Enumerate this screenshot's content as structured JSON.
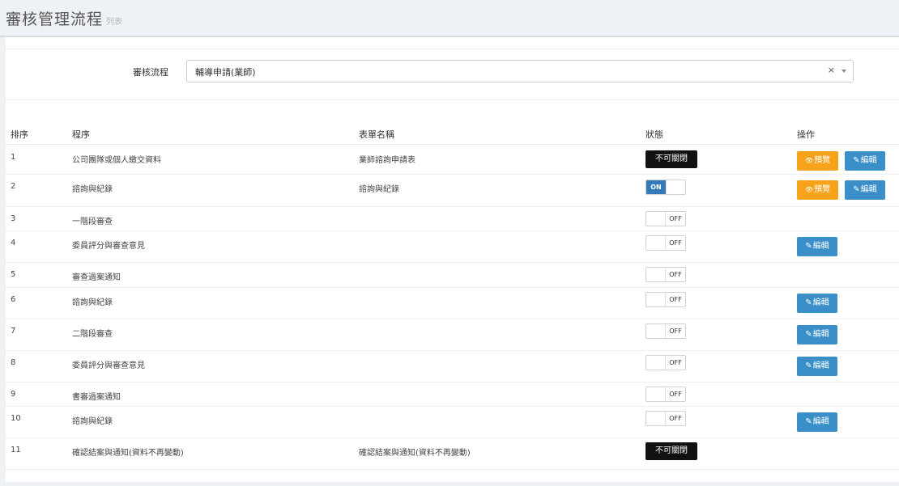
{
  "header": {
    "title": "審核管理流程",
    "subtitle": "列表"
  },
  "filter": {
    "label": "審核流程",
    "value": "輔導申請(業師)",
    "clear": "×"
  },
  "columns": {
    "num": "排序",
    "step": "程序",
    "form": "表單名稱",
    "status": "狀態",
    "actions": "操作"
  },
  "labels": {
    "locked": "不可關閉",
    "on": "ON",
    "off": "OFF",
    "preview": "預覽",
    "edit": "編輯"
  },
  "rows": [
    {
      "num": "1",
      "step": "公司團隊或個人繳交資料",
      "form": "業師諮詢申請表",
      "status": "locked",
      "preview": true,
      "edit": true
    },
    {
      "num": "2",
      "step": "諮詢與紀錄",
      "form": "諮詢與紀錄",
      "status": "on",
      "preview": true,
      "edit": true
    },
    {
      "num": "3",
      "step": "一階段審查",
      "form": "",
      "status": "off",
      "preview": false,
      "edit": false
    },
    {
      "num": "4",
      "step": "委員評分與審查意見",
      "form": "",
      "status": "off",
      "preview": false,
      "edit": true
    },
    {
      "num": "5",
      "step": "審查過案通知",
      "form": "",
      "status": "off",
      "preview": false,
      "edit": false
    },
    {
      "num": "6",
      "step": "諮詢與紀錄",
      "form": "",
      "status": "off",
      "preview": false,
      "edit": true
    },
    {
      "num": "7",
      "step": "二階段審查",
      "form": "",
      "status": "off",
      "preview": false,
      "edit": true
    },
    {
      "num": "8",
      "step": "委員評分與審查意見",
      "form": "",
      "status": "off",
      "preview": false,
      "edit": true
    },
    {
      "num": "9",
      "step": "書審過案通知",
      "form": "",
      "status": "off",
      "preview": false,
      "edit": false
    },
    {
      "num": "10",
      "step": "諮詢與紀錄",
      "form": "",
      "status": "off",
      "preview": false,
      "edit": true
    },
    {
      "num": "11",
      "step": "確認結案與通知(資料不再變動)",
      "form": "確認結案與通知(資料不再變動)",
      "status": "locked",
      "preview": false,
      "edit": false
    }
  ],
  "colors": {
    "orange": "#f7a21b",
    "blue": "#3a8fc9",
    "dark": "#111111",
    "toggle_on": "#337ab7"
  }
}
